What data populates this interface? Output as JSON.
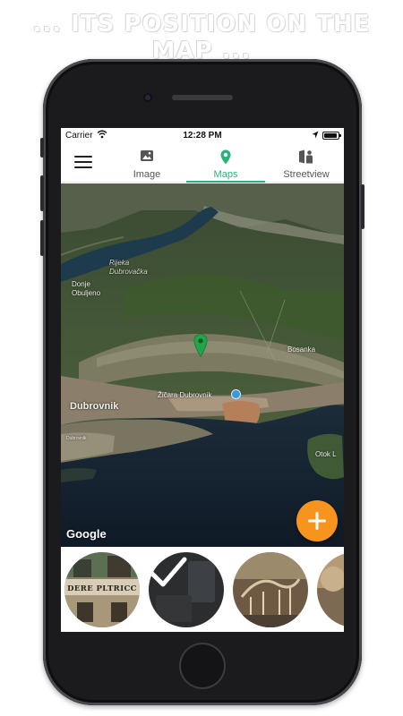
{
  "headline": "... ITS POSITION ON THE MAP ...",
  "status_bar": {
    "carrier": "Carrier",
    "time": "12:28 PM",
    "icons": [
      "wifi-icon",
      "location-arrow-icon",
      "battery-icon"
    ]
  },
  "nav": {
    "menu_icon": "hamburger-menu-icon",
    "tabs": [
      {
        "label": "Image",
        "icon": "image-icon",
        "active": false
      },
      {
        "label": "Maps",
        "icon": "map-pin-icon",
        "active": true
      },
      {
        "label": "Streetview",
        "icon": "streetview-icon",
        "active": false
      }
    ],
    "accent_color": "#29b27a"
  },
  "map": {
    "labels": {
      "rijeka": "Rijeka\nDubrovačka",
      "donje": "Donje\nObuljeno",
      "bosanka": "Bosanka",
      "zicara": "Žičara Dubrovnik",
      "dubrovnik": "Dubrovnik",
      "otok": "Otok L",
      "small": "Dubrovnik"
    },
    "attribution": "Google",
    "marker_icon": "map-marker-icon",
    "poi_icon": "cable-car-icon"
  },
  "fab": {
    "icon": "plus-icon",
    "color": "#f7941d"
  },
  "thumbnails": [
    {
      "name": "photo-building",
      "text": "DERE PLTRICC"
    },
    {
      "name": "photo-selected",
      "selected": true,
      "icon": "checkmark-icon"
    },
    {
      "name": "photo-dinosaur-museum"
    },
    {
      "name": "photo-partial"
    }
  ]
}
